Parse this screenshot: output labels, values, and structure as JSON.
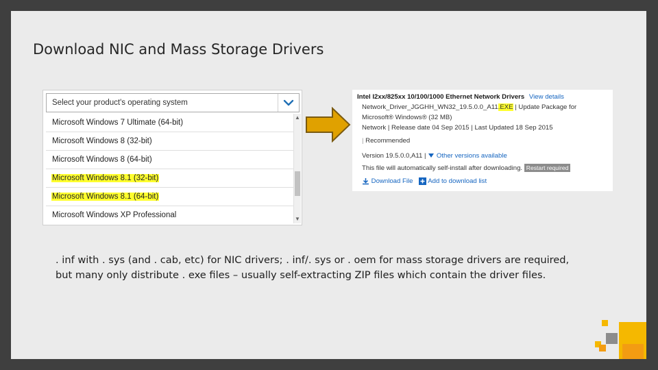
{
  "slide": {
    "title": "Download NIC and Mass Storage Drivers",
    "body": ". inf with . sys (and . cab, etc) for NIC drivers; . inf/. sys or . oem for mass storage drivers are required, but many only distribute . exe files – usually self-extracting ZIP files which contain the driver files."
  },
  "os_dropdown": {
    "placeholder": "Select your product's operating system",
    "options": [
      {
        "label": "Microsoft Windows 7 Ultimate (64-bit)",
        "highlighted": false
      },
      {
        "label": "Microsoft Windows 8 (32-bit)",
        "highlighted": false
      },
      {
        "label": "Microsoft Windows 8 (64-bit)",
        "highlighted": false
      },
      {
        "label": "Microsoft Windows 8.1 (32-bit)",
        "highlighted": true
      },
      {
        "label": "Microsoft Windows 8.1 (64-bit)",
        "highlighted": true
      },
      {
        "label": "Microsoft Windows XP Professional",
        "highlighted": false
      }
    ],
    "chevron_icon": "chevron-down-icon"
  },
  "driver_panel": {
    "title": "Intel I2xx/825xx 10/100/1000 Ethernet Network Drivers",
    "view_details": "View details",
    "line2_prefix": "Network_Driver_JGGHH_WN32_19.5.0.0_A11",
    "line2_ext": ".EXE",
    "line2_suffix": "| Update Package for",
    "line3": "Microsoft® Windows® (32 MB)",
    "line4": "Network | Release date 04 Sep 2015 | Last Updated 18 Sep 2015",
    "recommended": "Recommended",
    "version": "Version 19.5.0.0,A11 |",
    "other_versions": "Other versions available",
    "self_install": "This file will automatically self-install after downloading.",
    "restart_badge": "Restart required",
    "download_file": "Download File",
    "add_to_list": "Add to download list"
  },
  "colors": {
    "frame": "#3f3f3f",
    "slide_bg": "#ebebeb",
    "highlight": "#ffff2e",
    "arrow_fill": "#e0a100",
    "arrow_stroke": "#7a5a10",
    "link": "#1565c0",
    "accent_yellow": "#f5b800",
    "accent_orange": "#f39c12",
    "accent_grey": "#8c8c8c"
  }
}
